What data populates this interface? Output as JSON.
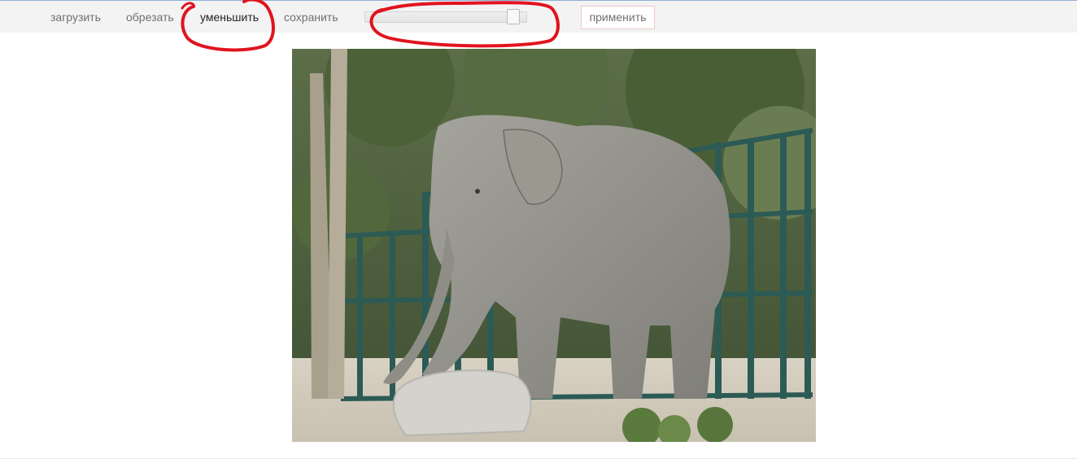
{
  "toolbar": {
    "items": [
      {
        "label": "загрузить"
      },
      {
        "label": "обрезать"
      },
      {
        "label": "уменьшить",
        "active": true
      },
      {
        "label": "сохранить"
      }
    ],
    "slider_value": 0.95,
    "apply_label": "применить"
  },
  "annotation_color": "#e0141e",
  "image": {
    "subject": "elephant-photo"
  }
}
